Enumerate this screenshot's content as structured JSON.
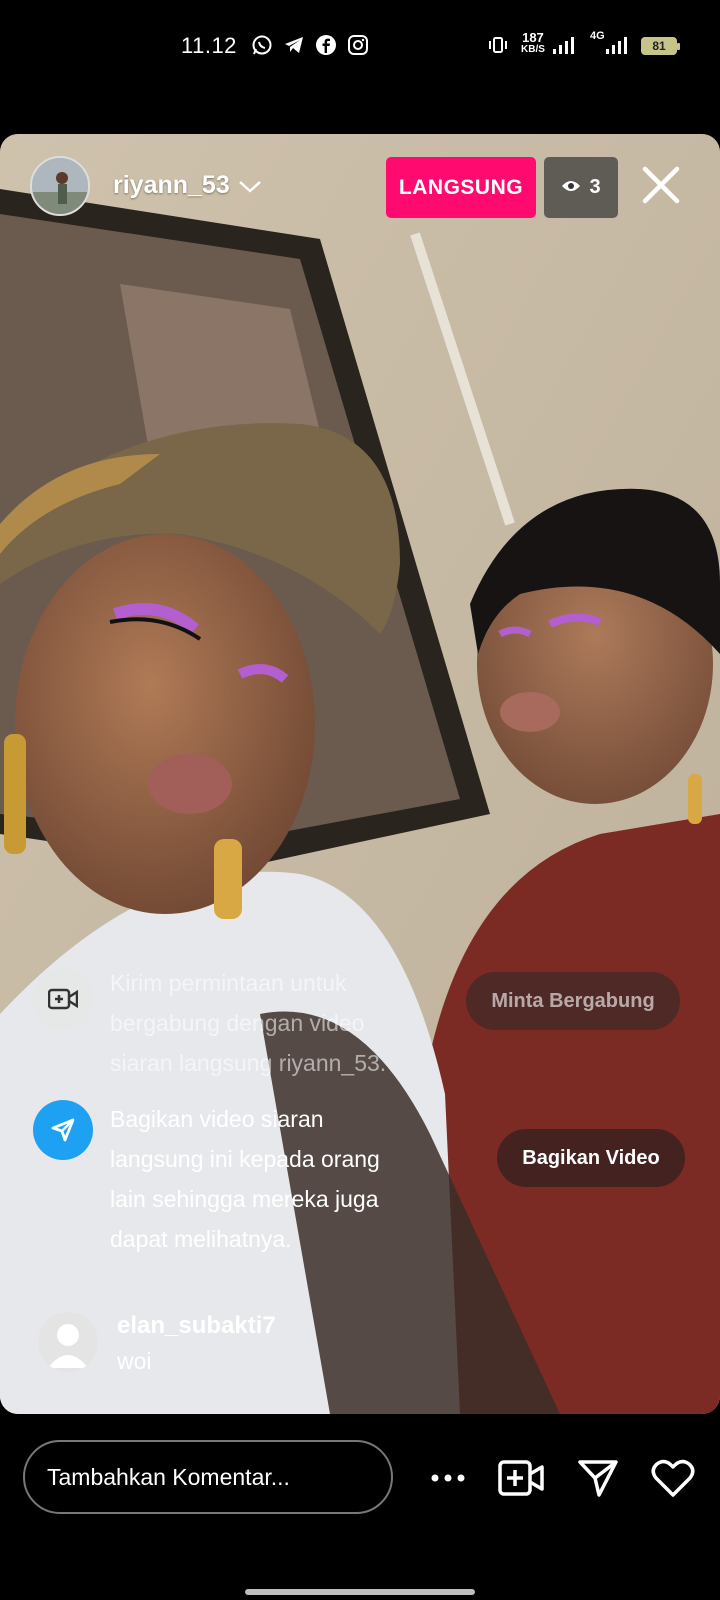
{
  "status_bar": {
    "time": "11.12",
    "net_speed_value": "187",
    "net_speed_unit": "KB/S",
    "network": "4G",
    "battery": "81",
    "app_icons": [
      "whatsapp-icon",
      "telegram-icon",
      "facebook-icon",
      "instagram-icon"
    ]
  },
  "live": {
    "host_username": "riyann_53",
    "live_label": "LANGSUNG",
    "viewer_count": "3",
    "live_color": "#ff0a6f"
  },
  "overlay": {
    "request": {
      "lines": [
        "Kirim permintaan untuk",
        "bergabung dengan video",
        "siaran langsung riyann_53."
      ],
      "button": "Minta Bergabung"
    },
    "share": {
      "lines": [
        "Bagikan video siaran",
        "langsung ini kepada orang",
        "lain sehingga mereka juga",
        "dapat melihatnya."
      ],
      "button": "Bagikan Video"
    },
    "comment": {
      "username": "elan_subakti7",
      "text": "woi"
    }
  },
  "bottom_bar": {
    "comment_placeholder": "Tambahkan Komentar..."
  }
}
